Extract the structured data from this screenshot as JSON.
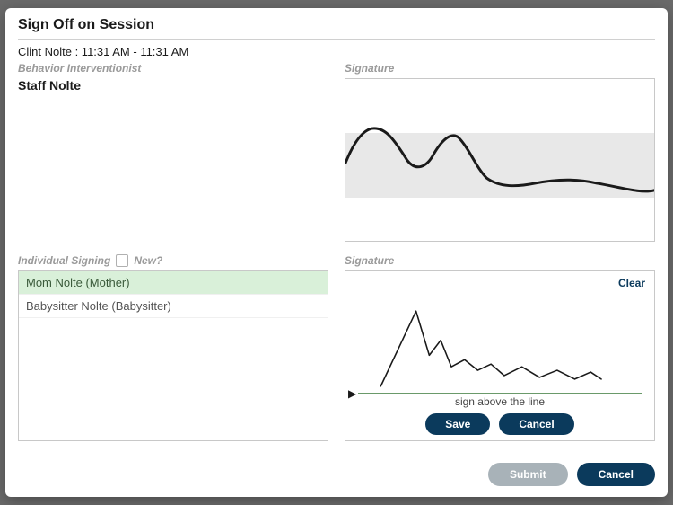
{
  "modal": {
    "title": "Sign Off on Session",
    "session_line": "Clint Nolte : 11:31 AM - 11:31 AM"
  },
  "interventionist": {
    "label": "Behavior Interventionist",
    "name": "Staff Nolte",
    "signature_label": "Signature"
  },
  "individual": {
    "label": "Individual Signing",
    "new_label": "New?",
    "signature_label": "Signature",
    "list": [
      {
        "text": "Mom Nolte (Mother)",
        "selected": true
      },
      {
        "text": "Babysitter Nolte (Babysitter)",
        "selected": false
      }
    ],
    "clear_label": "Clear",
    "sign_hint": "sign above the line",
    "save_label": "Save",
    "cancel_label": "Cancel"
  },
  "footer": {
    "submit_label": "Submit",
    "cancel_label": "Cancel"
  }
}
